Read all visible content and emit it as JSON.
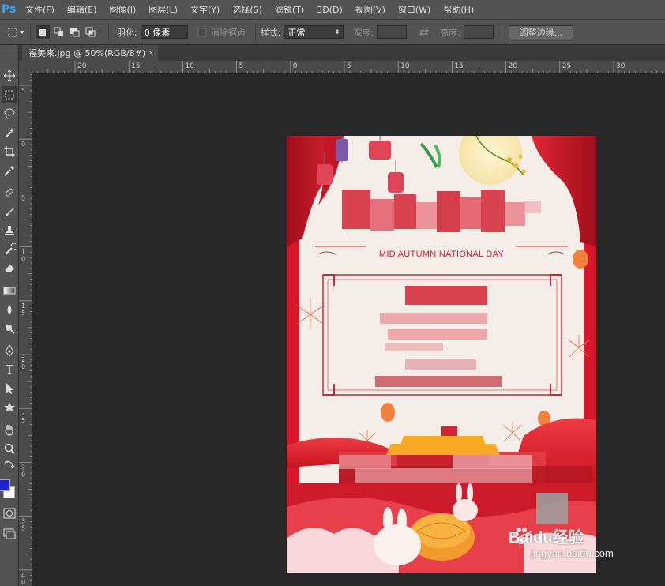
{
  "app": {
    "logo": "Ps"
  },
  "menu": [
    "文件(F)",
    "编辑(E)",
    "图像(I)",
    "图层(L)",
    "文字(Y)",
    "选择(S)",
    "滤镜(T)",
    "3D(D)",
    "视图(V)",
    "窗口(W)",
    "帮助(H)"
  ],
  "options": {
    "feather_label": "羽化:",
    "feather_value": "0 像素",
    "antialias_label": "消除锯齿",
    "style_label": "样式:",
    "style_value": "正常",
    "width_label": "宽度:",
    "height_label": "高度:",
    "refine_button": "调整边缘..."
  },
  "document_tab": {
    "title": "福美来.jpg @ 50%(RGB/8#)",
    "close": "×"
  },
  "ruler": {
    "h_labels": [
      "20",
      "15",
      "10",
      "5",
      "0",
      "5",
      "10",
      "15",
      "20",
      "25",
      "30"
    ],
    "v_labels": [
      "5",
      "0",
      "5",
      "1\n0",
      "1\n5",
      "2\n0",
      "2\n5",
      "3\n0",
      "3\n5",
      "4\n0"
    ]
  },
  "poster": {
    "subtitle": "MID AUTUMN NATIONAL DAY"
  },
  "watermark": {
    "brand": "Baidu经验",
    "url": "jingyan.baidu.com"
  },
  "colors": {
    "foreground": "#1a22c8",
    "background": "#ffffff",
    "accent_red": "#d9172a"
  }
}
